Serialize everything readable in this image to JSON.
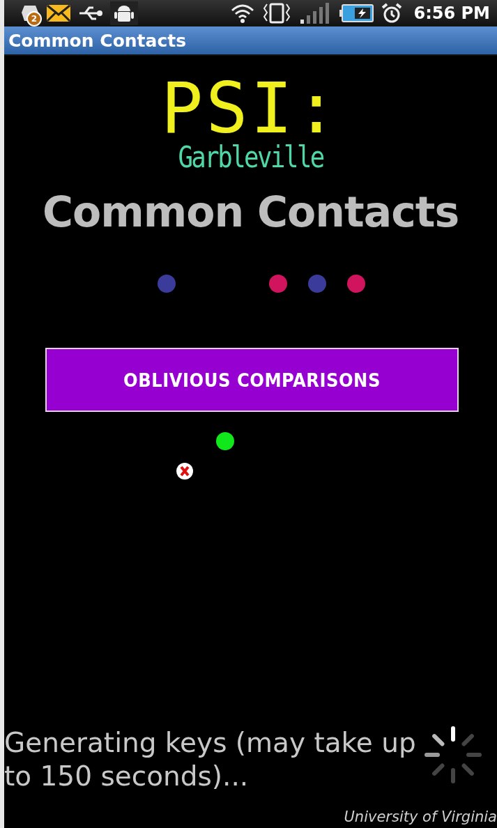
{
  "status_bar": {
    "notification_count": "2",
    "time": "6:56 PM"
  },
  "title_bar": {
    "title": "Common Contacts"
  },
  "logo": {
    "title": "PSI:",
    "subtitle": "Garbleville"
  },
  "heading": "Common Contacts",
  "dots": [
    {
      "color": "#3b3b9c"
    },
    {
      "color": "#d0145e"
    },
    {
      "color": "#3b3b9c"
    },
    {
      "color": "#d0145e"
    },
    {
      "color": "#11e81c"
    }
  ],
  "button": {
    "label": "OBLIVIOUS COMPARISONS"
  },
  "status_message": "Generating keys (may take up to 150 seconds)...",
  "footer": "University of Virginia"
}
